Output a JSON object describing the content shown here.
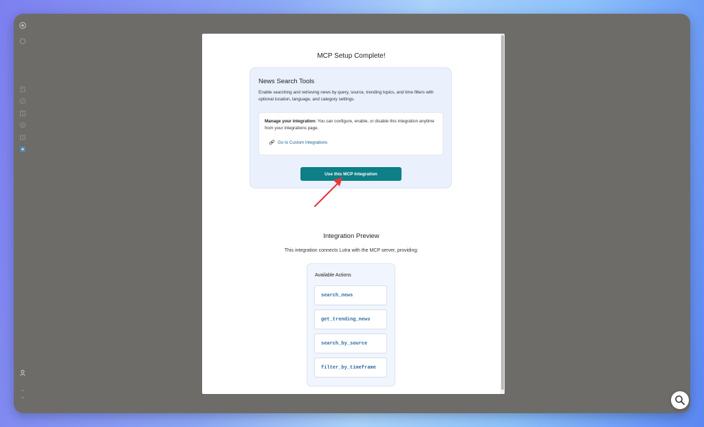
{
  "modal": {
    "title": "MCP Setup Complete!"
  },
  "tool": {
    "title": "News Search Tools",
    "description": "Enable searching and retrieving news by query, source, trending topics, and time filters with optional location, language, and category settings.",
    "manage_label": "Manage your integration:",
    "manage_text": "You can configure, enable, or disable this integration anytime from your integrations page.",
    "link_label": "Go to Custom Integrations",
    "use_button_label": "Use this MCP Integration"
  },
  "preview": {
    "title": "Integration Preview",
    "subtitle": "This integration connects Lutra with the MCP server, providing:",
    "actions_title": "Available Actions",
    "actions": [
      "search_news",
      "get_trending_news",
      "search_by_source",
      "filter_by_timeframe"
    ]
  },
  "colors": {
    "accent": "#0d7f86",
    "arrow": "#e8373a"
  }
}
